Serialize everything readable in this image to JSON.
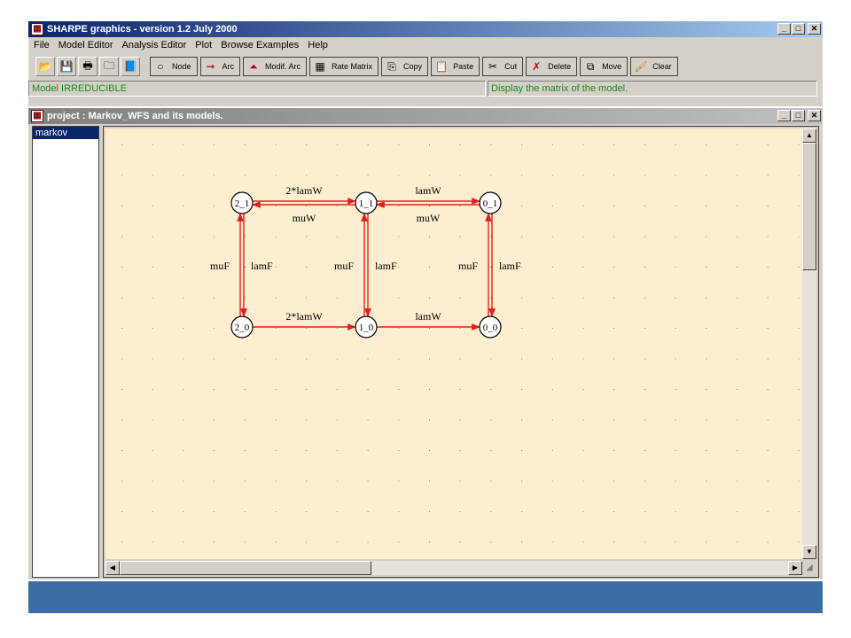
{
  "window": {
    "title": "SHARPE graphics  -  version 1.2  July 2000"
  },
  "menu": [
    "File",
    "Model Editor",
    "Analysis Editor",
    "Plot",
    "Browse Examples",
    "Help"
  ],
  "toolbar": {
    "icons": [
      "open-folder-icon",
      "save-icon",
      "print-icon",
      "new-folder-icon",
      "book-icon"
    ],
    "buttons": [
      {
        "label": "Node",
        "icon": "node-icon"
      },
      {
        "label": "Arc",
        "icon": "arc-icon"
      },
      {
        "label": "Modif. Arc",
        "icon": "modify-arc-icon"
      },
      {
        "label": "Rate Matrix",
        "icon": "rate-matrix-icon"
      },
      {
        "label": "Copy",
        "icon": "copy-icon"
      },
      {
        "label": "Paste",
        "icon": "paste-icon"
      },
      {
        "label": "Cut",
        "icon": "scissors-icon"
      },
      {
        "label": "Delete",
        "icon": "delete-icon"
      },
      {
        "label": "Move",
        "icon": "move-icon"
      },
      {
        "label": "Clear",
        "icon": "clear-icon"
      }
    ]
  },
  "status": {
    "left": "Model IRREDUCIBLE",
    "right": "Display the matrix of the model."
  },
  "project": {
    "title": "project : Markov_WFS and its models.",
    "models": [
      "markov"
    ]
  },
  "graph": {
    "nodes": [
      "2_1",
      "1_1",
      "0_1",
      "2_0",
      "1_0",
      "0_0"
    ],
    "arcs": [
      {
        "from": "2_1",
        "to": "1_1",
        "label": "2*lamW"
      },
      {
        "from": "1_1",
        "to": "2_1",
        "label": "muW"
      },
      {
        "from": "1_1",
        "to": "0_1",
        "label": "lamW"
      },
      {
        "from": "0_1",
        "to": "1_1",
        "label": "muW"
      },
      {
        "from": "2_0",
        "to": "1_0",
        "label": "2*lamW"
      },
      {
        "from": "1_0",
        "to": "0_0",
        "label": "lamW"
      },
      {
        "from": "2_1",
        "to": "2_0",
        "label": "lamF"
      },
      {
        "from": "2_0",
        "to": "2_1",
        "label": "muF"
      },
      {
        "from": "1_1",
        "to": "1_0",
        "label": "lamF"
      },
      {
        "from": "1_0",
        "to": "1_1",
        "label": "muF"
      },
      {
        "from": "0_1",
        "to": "0_0",
        "label": "lamF"
      },
      {
        "from": "0_0",
        "to": "0_1",
        "label": "muF"
      }
    ],
    "arc_color": "#e02020",
    "canvas_color": "#fdeecf"
  }
}
